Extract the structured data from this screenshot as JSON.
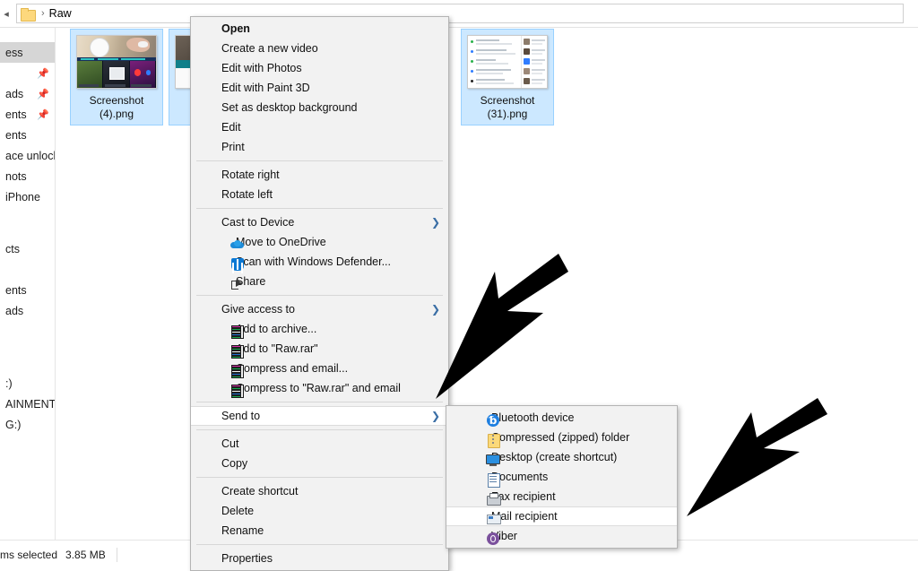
{
  "window": {
    "addressbar": {
      "back_icon": "back-chevron-icon",
      "folder_icon": "folder-icon",
      "separator": "›",
      "path_label": "Raw"
    },
    "statusbar": {
      "selection_text": "ms selected",
      "size_text": "3.85 MB"
    }
  },
  "navpane": {
    "items": [
      {
        "label": "ess",
        "selected": true,
        "pin": false
      },
      {
        "label": "",
        "selected": false,
        "pin": true
      },
      {
        "label": "ads",
        "selected": false,
        "pin": true
      },
      {
        "label": "ents",
        "selected": false,
        "pin": true
      },
      {
        "label": "ents",
        "selected": false,
        "pin": false
      },
      {
        "label": "ace unlock",
        "selected": false,
        "pin": false
      },
      {
        "label": "nots",
        "selected": false,
        "pin": false
      },
      {
        "label": "iPhone",
        "selected": false,
        "pin": false
      },
      {
        "label": "cts",
        "selected": false,
        "pin": false
      },
      {
        "label": "ents",
        "selected": false,
        "pin": false
      },
      {
        "label": "ads",
        "selected": false,
        "pin": false
      },
      {
        "label": ":)",
        "selected": false,
        "pin": false
      },
      {
        "label": "AINMENT (F",
        "selected": false,
        "pin": false
      },
      {
        "label": "G:)",
        "selected": false,
        "pin": false
      }
    ]
  },
  "files": [
    {
      "name_line1": "Screenshot",
      "name_line2": "(4).png",
      "selected": true
    },
    {
      "name_line1": "",
      "name_line2": "",
      "selected": true
    },
    {
      "name_line1": "Screenshot",
      "name_line2": "(31).png",
      "selected": true
    }
  ],
  "context_menu": {
    "items": [
      {
        "label": "Open",
        "bold": true,
        "icon": null,
        "submenu": false,
        "highlighted": false
      },
      {
        "label": "Create a new video",
        "bold": false,
        "icon": null,
        "submenu": false,
        "highlighted": false
      },
      {
        "label": "Edit with Photos",
        "bold": false,
        "icon": null,
        "submenu": false,
        "highlighted": false
      },
      {
        "label": "Edit with Paint 3D",
        "bold": false,
        "icon": null,
        "submenu": false,
        "highlighted": false
      },
      {
        "label": "Set as desktop background",
        "bold": false,
        "icon": null,
        "submenu": false,
        "highlighted": false
      },
      {
        "label": "Edit",
        "bold": false,
        "icon": null,
        "submenu": false,
        "highlighted": false
      },
      {
        "label": "Print",
        "bold": false,
        "icon": null,
        "submenu": false,
        "highlighted": false
      },
      {
        "separator": true
      },
      {
        "label": "Rotate right",
        "bold": false,
        "icon": null,
        "submenu": false,
        "highlighted": false
      },
      {
        "label": "Rotate left",
        "bold": false,
        "icon": null,
        "submenu": false,
        "highlighted": false
      },
      {
        "separator": true
      },
      {
        "label": "Cast to Device",
        "bold": false,
        "icon": null,
        "submenu": true,
        "highlighted": false
      },
      {
        "label": "Move to OneDrive",
        "bold": false,
        "icon": "onedrive-icon",
        "submenu": false,
        "highlighted": false
      },
      {
        "label": "Scan with Windows Defender...",
        "bold": false,
        "icon": "windows-defender-icon",
        "submenu": false,
        "highlighted": false
      },
      {
        "label": "Share",
        "bold": false,
        "icon": "share-icon",
        "submenu": false,
        "highlighted": false
      },
      {
        "separator": true
      },
      {
        "label": "Give access to",
        "bold": false,
        "icon": null,
        "submenu": true,
        "highlighted": false
      },
      {
        "label": "Add to archive...",
        "bold": false,
        "icon": "winrar-icon",
        "submenu": false,
        "highlighted": false
      },
      {
        "label": "Add to \"Raw.rar\"",
        "bold": false,
        "icon": "winrar-icon",
        "submenu": false,
        "highlighted": false
      },
      {
        "label": "Compress and email...",
        "bold": false,
        "icon": "winrar-icon",
        "submenu": false,
        "highlighted": false
      },
      {
        "label": "Compress to \"Raw.rar\" and email",
        "bold": false,
        "icon": "winrar-icon",
        "submenu": false,
        "highlighted": false
      },
      {
        "separator": true
      },
      {
        "label": "Send to",
        "bold": false,
        "icon": null,
        "submenu": true,
        "highlighted": true
      },
      {
        "separator": true
      },
      {
        "label": "Cut",
        "bold": false,
        "icon": null,
        "submenu": false,
        "highlighted": false
      },
      {
        "label": "Copy",
        "bold": false,
        "icon": null,
        "submenu": false,
        "highlighted": false
      },
      {
        "separator": true
      },
      {
        "label": "Create shortcut",
        "bold": false,
        "icon": null,
        "submenu": false,
        "highlighted": false
      },
      {
        "label": "Delete",
        "bold": false,
        "icon": null,
        "submenu": false,
        "highlighted": false
      },
      {
        "label": "Rename",
        "bold": false,
        "icon": null,
        "submenu": false,
        "highlighted": false
      },
      {
        "separator": true
      },
      {
        "label": "Properties",
        "bold": false,
        "icon": null,
        "submenu": false,
        "highlighted": false
      }
    ]
  },
  "send_to_submenu": {
    "items": [
      {
        "label": "Bluetooth device",
        "icon": "bluetooth-icon",
        "highlighted": false
      },
      {
        "label": "Compressed (zipped) folder",
        "icon": "zip-folder-icon",
        "highlighted": false
      },
      {
        "label": "Desktop (create shortcut)",
        "icon": "desktop-icon",
        "highlighted": false
      },
      {
        "label": "Documents",
        "icon": "documents-icon",
        "highlighted": false
      },
      {
        "label": "Fax recipient",
        "icon": "fax-icon",
        "highlighted": false
      },
      {
        "label": "Mail recipient",
        "icon": "mail-icon",
        "highlighted": true
      },
      {
        "label": "Viber",
        "icon": "viber-icon",
        "highlighted": false
      }
    ]
  },
  "annotations": {
    "arrows": [
      {
        "name": "arrow-pointing-to-send-to"
      },
      {
        "name": "arrow-pointing-to-mail-recipient"
      }
    ]
  },
  "colors": {
    "selection_fill": "#cce8ff",
    "selection_border": "#99d1ff",
    "menu_background": "#f2f2f2",
    "menu_border": "#b4b4b4",
    "highlight_background": "#ffffff",
    "submenu_chevron": "#3a6ea5",
    "nav_selected": "#d6d6d6"
  }
}
